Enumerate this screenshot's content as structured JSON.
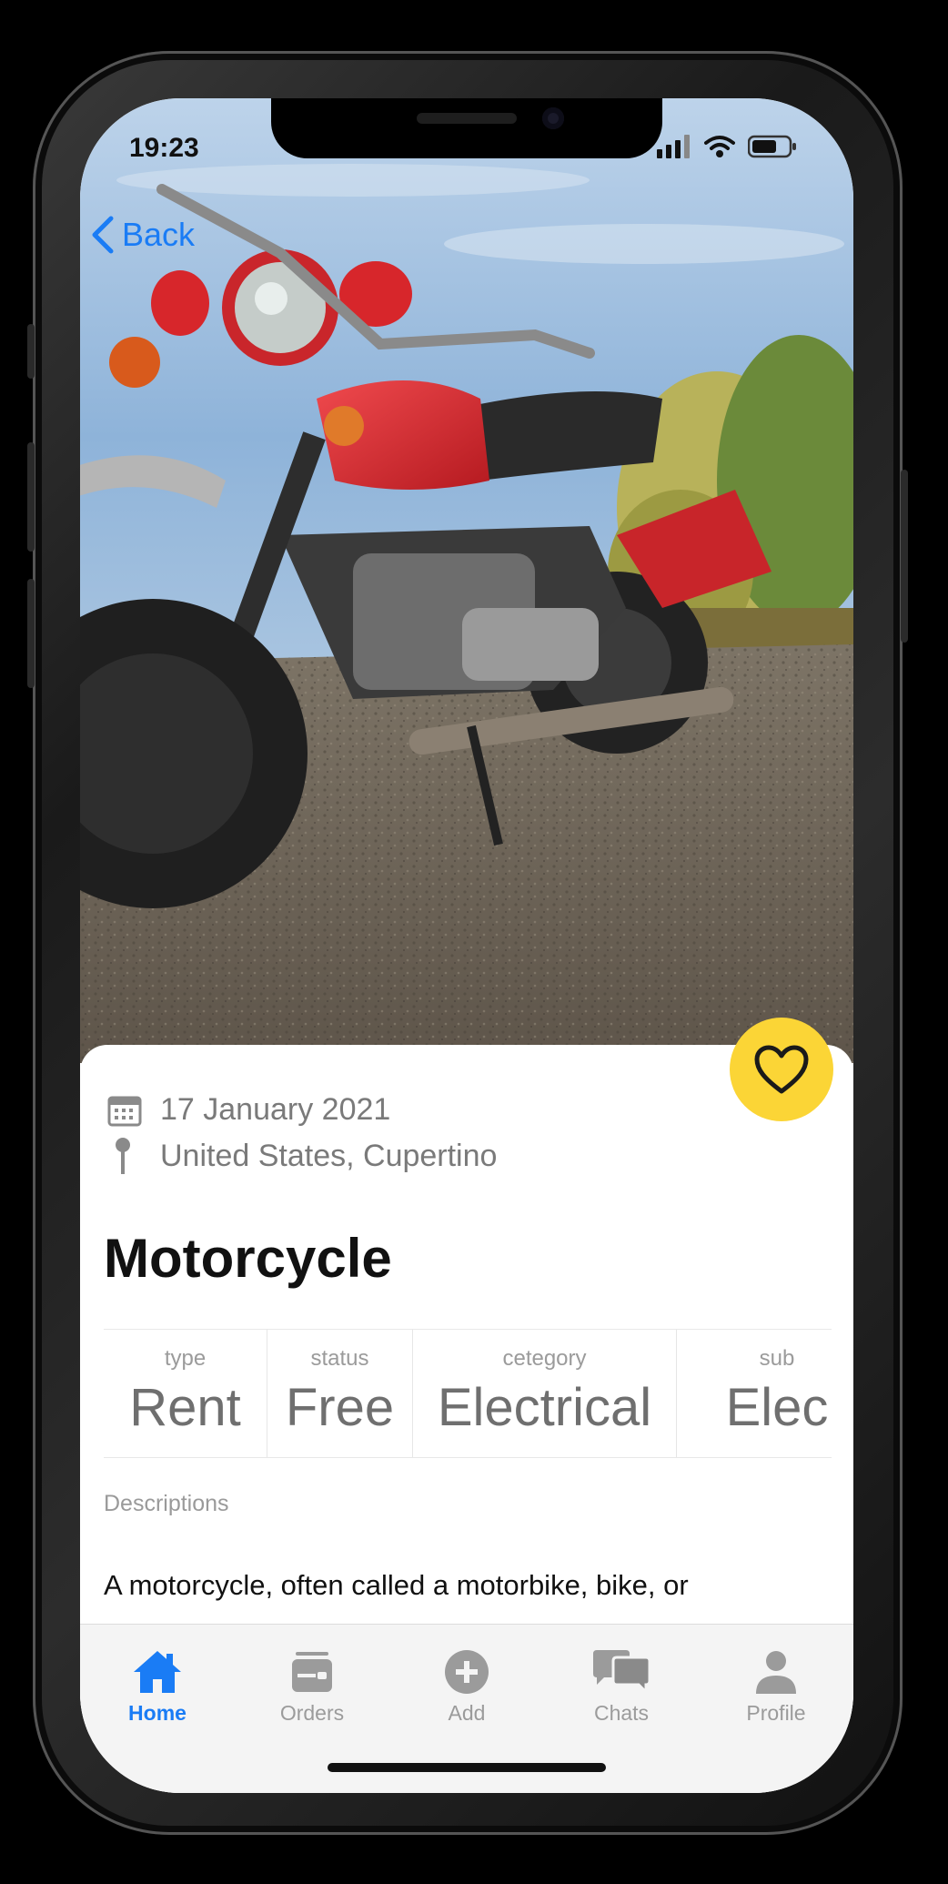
{
  "status_bar": {
    "time": "19:23"
  },
  "nav": {
    "back_label": "Back"
  },
  "listing": {
    "date": "17 January 2021",
    "location": "United States, Cupertino",
    "title": "Motorcycle",
    "specs": [
      {
        "label": "type",
        "value": "Rent"
      },
      {
        "label": "status",
        "value": "Free"
      },
      {
        "label": "cetegory",
        "value": "Electrical"
      },
      {
        "label": "sub",
        "value": "Elec"
      }
    ],
    "description_label": "Descriptions",
    "description": "A motorcycle, often called a motorbike, bike, or"
  },
  "tab_bar": {
    "items": [
      {
        "label": "Home",
        "icon": "home-icon",
        "active": true
      },
      {
        "label": "Orders",
        "icon": "orders-icon",
        "active": false
      },
      {
        "label": "Add",
        "icon": "add-icon",
        "active": false
      },
      {
        "label": "Chats",
        "icon": "chats-icon",
        "active": false
      },
      {
        "label": "Profile",
        "icon": "profile-icon",
        "active": false
      }
    ]
  },
  "colors": {
    "accent": "#1a7cf5",
    "favorite": "#fbd536",
    "bike": "#d7262b"
  }
}
